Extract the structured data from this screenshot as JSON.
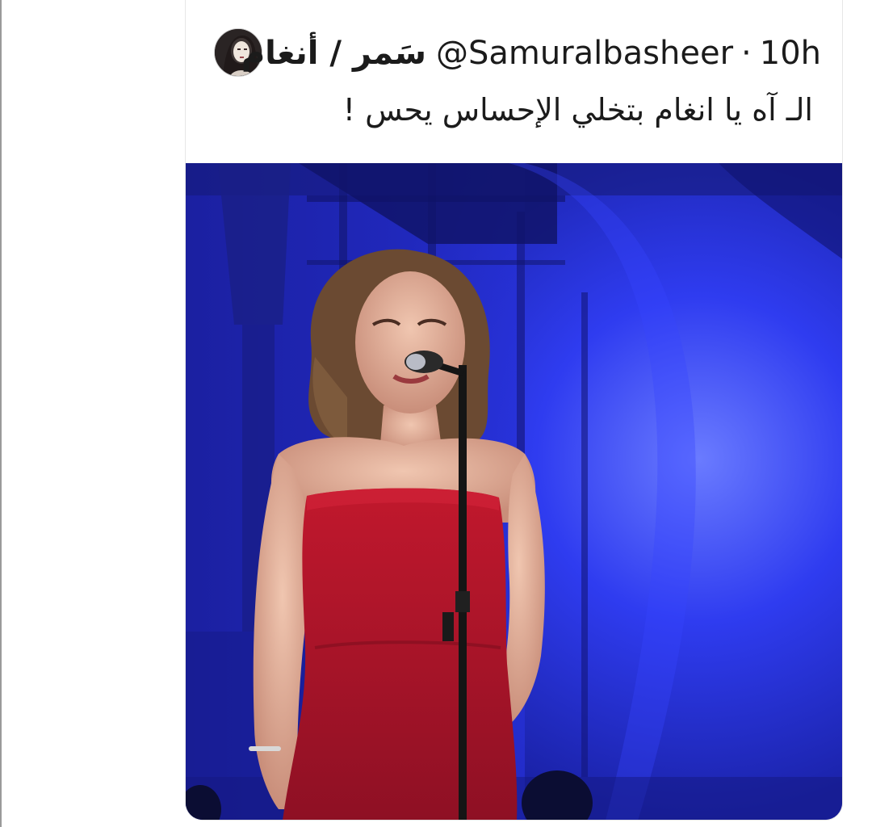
{
  "tweet": {
    "display_name": "سَمر / أنغام",
    "handle": "@Samuralbasheer",
    "separator": "·",
    "time_ago": "10h",
    "text": "الـ آه يا انغام بتخلي الإحساس يحس !"
  },
  "avatar": {
    "icon": "user-avatar"
  },
  "media": {
    "kind": "video-still",
    "subject": "singer-on-stage"
  },
  "colors": {
    "stage_blue": "#2b2fd8",
    "dress_red": "#b5162a",
    "text": "#1b1b1b"
  }
}
